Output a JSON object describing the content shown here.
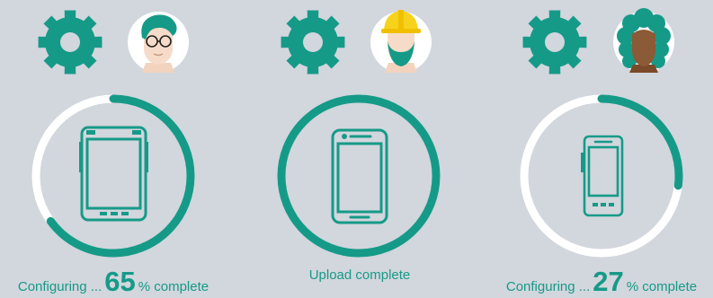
{
  "colors": {
    "background": "#d2d6dd",
    "accent": "#169a88",
    "ring_track": "#ffffff",
    "avatar_bg": "#ffffff"
  },
  "devices": [
    {
      "device_icon": "rugged-tablet-icon",
      "user_icon": "user-with-glasses-icon",
      "progress": 0.65,
      "status": {
        "prefix": "Configuring ...",
        "percent": "65",
        "suffix": "% complete"
      }
    },
    {
      "device_icon": "smartphone-icon",
      "user_icon": "worker-with-hard-hat-icon",
      "progress": 1.0,
      "status": {
        "text": "Upload complete"
      }
    },
    {
      "device_icon": "rugged-handheld-icon",
      "user_icon": "user-with-curly-hair-icon",
      "progress": 0.27,
      "status": {
        "prefix": "Configuring ...",
        "percent": "27",
        "suffix": "% complete"
      }
    }
  ]
}
